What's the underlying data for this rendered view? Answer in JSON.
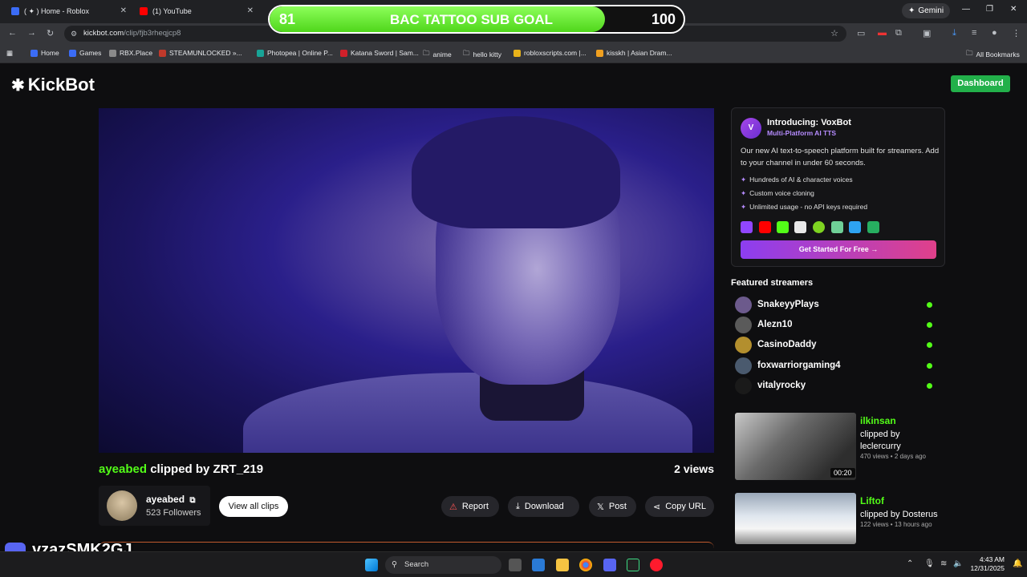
{
  "browser": {
    "tabs": [
      {
        "label": "( ✦ ) Home - Roblox"
      },
      {
        "label": "(1) YouTube"
      }
    ],
    "gemini_label": "Gemini",
    "url_domain": "kickbot.com",
    "url_path": "/clip/fjb3rheqjcp8",
    "bookmarks": [
      "Home",
      "Games",
      "RBX.Place",
      "STEAMUNLOCKED »...",
      "Photopea | Online P...",
      "Katana Sword | Sam...",
      "anime",
      "hello kitty",
      "robloxscripts.com |...",
      "kisskh | Asian Dram..."
    ],
    "all_bookmarks": "All Bookmarks"
  },
  "overlay": {
    "subgoal_current": "81",
    "subgoal_title": "BAC TATTOO SUB GOAL",
    "subgoal_target": "100",
    "subgoal_progress": 0.81,
    "discord_handle": "vzazSMK2GJ"
  },
  "site": {
    "logo": "KickBot",
    "dashboard_label": "Dashboard"
  },
  "clip": {
    "streamer": "ayeabed",
    "clipped_by_text": " clipped by ZRT_219",
    "views": "2 views",
    "author_name": "ayeabed",
    "followers": "523 Followers",
    "view_all_label": "View all clips",
    "actions": {
      "report": "Report",
      "download": "Download",
      "post": "Post",
      "copy_url": "Copy URL"
    }
  },
  "promo": {
    "logo_text": "V",
    "title": "Introducing: VoxBot",
    "subtitle": "Multi-Platform AI TTS",
    "description": "Our new AI text-to-speech platform built for streamers. Add to your channel in under 60 seconds.",
    "features": [
      "Hundreds of AI & character voices",
      "Custom voice cloning",
      "Unlimited usage - no API keys required"
    ],
    "cta": "Get Started For Free →"
  },
  "featured": {
    "title": "Featured streamers",
    "streamers": [
      "SnakeyyPlays",
      "Alezn10",
      "CasinoDaddy",
      "foxwarriorgaming4",
      "vitalyrocky"
    ]
  },
  "related": [
    {
      "name": "ilkinsan",
      "clipped_by": "clipped by leclercurry",
      "meta": "470 views • 2 days ago",
      "duration": "00:20"
    },
    {
      "name": "Liftof",
      "clipped_by": "clipped by Dosterus",
      "meta": "122 views • 13 hours ago",
      "duration": ""
    }
  ],
  "taskbar": {
    "search_placeholder": "Search",
    "time": "4:43 AM",
    "date": "12/31/2025"
  },
  "colors": {
    "kick_green": "#53fc18",
    "dashboard_green": "#22b04a",
    "background": "#0e0e10",
    "promo_purple": "#8c3ef0"
  }
}
